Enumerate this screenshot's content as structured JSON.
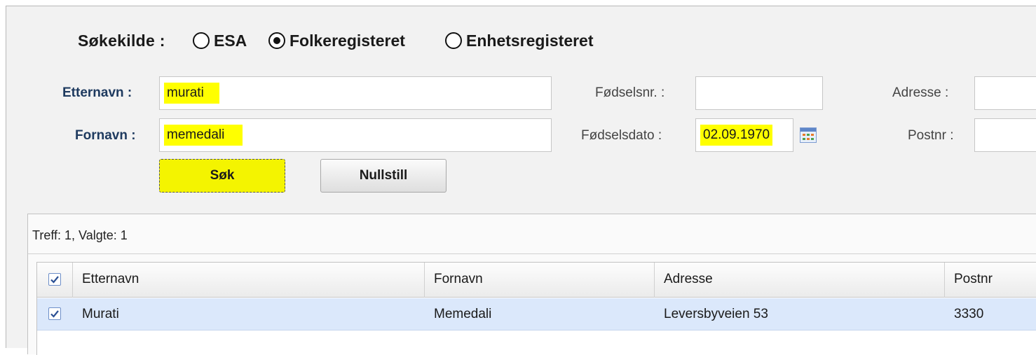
{
  "search_source": {
    "label": "Søkekilde :",
    "options": [
      {
        "label": "ESA",
        "checked": false
      },
      {
        "label": "Folkeregisteret",
        "checked": true
      },
      {
        "label": "Enhetsregisteret",
        "checked": false
      }
    ]
  },
  "form": {
    "etternavn_label": "Etternavn :",
    "etternavn_value": "murati",
    "fornavn_label": "Fornavn :",
    "fornavn_value": "memedali",
    "fodselsnr_label": "Fødselsnr. :",
    "fodselsnr_value": "",
    "fodselsdato_label": "Fødselsdato :",
    "fodselsdato_value": "02.09.1970",
    "adresse_label": "Adresse :",
    "adresse_value": "",
    "postnr_label": "Postnr :",
    "postnr_value": ""
  },
  "buttons": {
    "search_label": "Søk",
    "reset_label": "Nullstill"
  },
  "results": {
    "status": "Treff: 1, Valgte: 1",
    "columns": [
      "Etternavn",
      "Fornavn",
      "Adresse",
      "Postnr"
    ],
    "header_checked": true,
    "rows": [
      {
        "checked": true,
        "etternavn": "Murati",
        "fornavn": "Memedali",
        "adresse": "Leversbyveien 53",
        "postnr": "3330"
      }
    ]
  },
  "colors": {
    "highlight": "#ffff00",
    "selected_row": "#dbe8fb",
    "label_blue": "#1e3a5f"
  },
  "icons": [
    "calendar-icon",
    "checkbox-checked-icon"
  ]
}
